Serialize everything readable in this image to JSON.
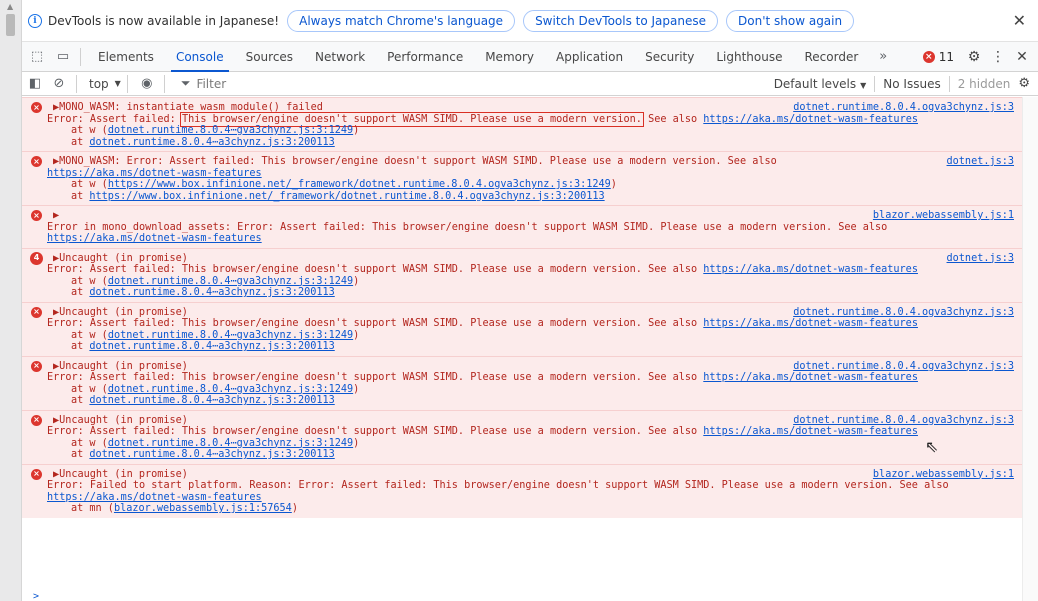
{
  "infobar": {
    "text": "DevTools is now available in Japanese!",
    "buttons": [
      "Always match Chrome's language",
      "Switch DevTools to Japanese",
      "Don't show again"
    ],
    "close": "✕"
  },
  "tabs": [
    "Elements",
    "Console",
    "Sources",
    "Network",
    "Performance",
    "Memory",
    "Application",
    "Security",
    "Lighthouse",
    "Recorder"
  ],
  "active_tab": "Console",
  "more_tabs": "»",
  "error_count": "11",
  "toolbar": {
    "context": "top",
    "filter_placeholder": "Filter",
    "levels": "Default levels",
    "issues": "No Issues",
    "hidden": "2 hidden"
  },
  "colors": {
    "error_bg": "#fcebeb",
    "error_text": "#b3261e",
    "link": "#0b57d0",
    "accent": "#0b57d0"
  },
  "messages": [
    {
      "icon": "×",
      "source": "dotnet.runtime.8.0.4.ogva3chynz.js:3",
      "head": "▶MONO_WASM: instantiate_wasm_module() failed",
      "l2_prefix": "Error: Assert failed: ",
      "l2_boxed": "This browser/engine doesn't support WASM SIMD. Please use a modern version.",
      "l2_mid": " See also ",
      "l2_link": "https://aka.ms/dotnet-wasm-features",
      "stack": [
        {
          "pre": "at w (",
          "link": "dotnet.runtime.8.0.4⋯gva3chynz.js:3:1249",
          "post": ")"
        },
        {
          "pre": "at ",
          "link": "dotnet.runtime.8.0.4⋯a3chynz.js:3:200113",
          "post": ""
        }
      ]
    },
    {
      "icon": "×",
      "source": "dotnet.js:3",
      "head": "▶MONO_WASM: Error: Assert failed: This browser/engine doesn't support WASM SIMD. Please use a modern version. See also",
      "l2_link": "https://aka.ms/dotnet-wasm-features",
      "stack": [
        {
          "pre": "at w (",
          "link": "https://www.box.infinione.net/_framework/dotnet.runtime.8.0.4.ogva3chynz.js:3:1249",
          "post": ")"
        },
        {
          "pre": "at ",
          "link": "https://www.box.infinione.net/_framework/dotnet.runtime.8.0.4.ogva3chynz.js:3:200113",
          "post": ""
        }
      ]
    },
    {
      "icon": "×",
      "source": "blazor.webassembly.js:1",
      "head": "▶",
      "l2_text": "Error in mono_download_assets: Error: Assert failed: This browser/engine doesn't support WASM SIMD. Please use a modern version. See also",
      "l3_link": "https://aka.ms/dotnet-wasm-features"
    },
    {
      "icon": "4",
      "source": "dotnet.js:3",
      "head": "▶Uncaught (in promise)",
      "l2_text": "Error: Assert failed: This browser/engine doesn't support WASM SIMD. Please use a modern version. See also ",
      "l2_link": "https://aka.ms/dotnet-wasm-features",
      "stack": [
        {
          "pre": "at w (",
          "link": "dotnet.runtime.8.0.4⋯gva3chynz.js:3:1249",
          "post": ")"
        },
        {
          "pre": "at ",
          "link": "dotnet.runtime.8.0.4⋯a3chynz.js:3:200113",
          "post": ""
        }
      ]
    },
    {
      "icon": "×",
      "source": "dotnet.runtime.8.0.4.ogva3chynz.js:3",
      "head": "▶Uncaught (in promise)",
      "l2_text": "Error: Assert failed: This browser/engine doesn't support WASM SIMD. Please use a modern version. See also ",
      "l2_link": "https://aka.ms/dotnet-wasm-features",
      "stack": [
        {
          "pre": "at w (",
          "link": "dotnet.runtime.8.0.4⋯gva3chynz.js:3:1249",
          "post": ")"
        },
        {
          "pre": "at ",
          "link": "dotnet.runtime.8.0.4⋯a3chynz.js:3:200113",
          "post": ""
        }
      ]
    },
    {
      "icon": "×",
      "source": "dotnet.runtime.8.0.4.ogva3chynz.js:3",
      "head": "▶Uncaught (in promise)",
      "l2_text": "Error: Assert failed: This browser/engine doesn't support WASM SIMD. Please use a modern version. See also ",
      "l2_link": "https://aka.ms/dotnet-wasm-features",
      "stack": [
        {
          "pre": "at w (",
          "link": "dotnet.runtime.8.0.4⋯gva3chynz.js:3:1249",
          "post": ")"
        },
        {
          "pre": "at ",
          "link": "dotnet.runtime.8.0.4⋯a3chynz.js:3:200113",
          "post": ""
        }
      ]
    },
    {
      "icon": "×",
      "source": "dotnet.runtime.8.0.4.ogva3chynz.js:3",
      "head": "▶Uncaught (in promise)",
      "l2_text": "Error: Assert failed: This browser/engine doesn't support WASM SIMD. Please use a modern version. See also ",
      "l2_link": "https://aka.ms/dotnet-wasm-features",
      "stack": [
        {
          "pre": "at w (",
          "link": "dotnet.runtime.8.0.4⋯gva3chynz.js:3:1249",
          "post": ")"
        },
        {
          "pre": "at ",
          "link": "dotnet.runtime.8.0.4⋯a3chynz.js:3:200113",
          "post": ""
        }
      ]
    },
    {
      "icon": "×",
      "source": "blazor.webassembly.js:1",
      "head": "▶Uncaught (in promise)",
      "l2_text": "Error: Failed to start platform. Reason: Error: Assert failed: This browser/engine doesn't support WASM SIMD. Please use a modern version. See also",
      "l3_link": "https://aka.ms/dotnet-wasm-features",
      "stack": [
        {
          "pre": "at mn (",
          "link": "blazor.webassembly.js:1:57654",
          "post": ")"
        }
      ]
    }
  ],
  "prompt": ">"
}
